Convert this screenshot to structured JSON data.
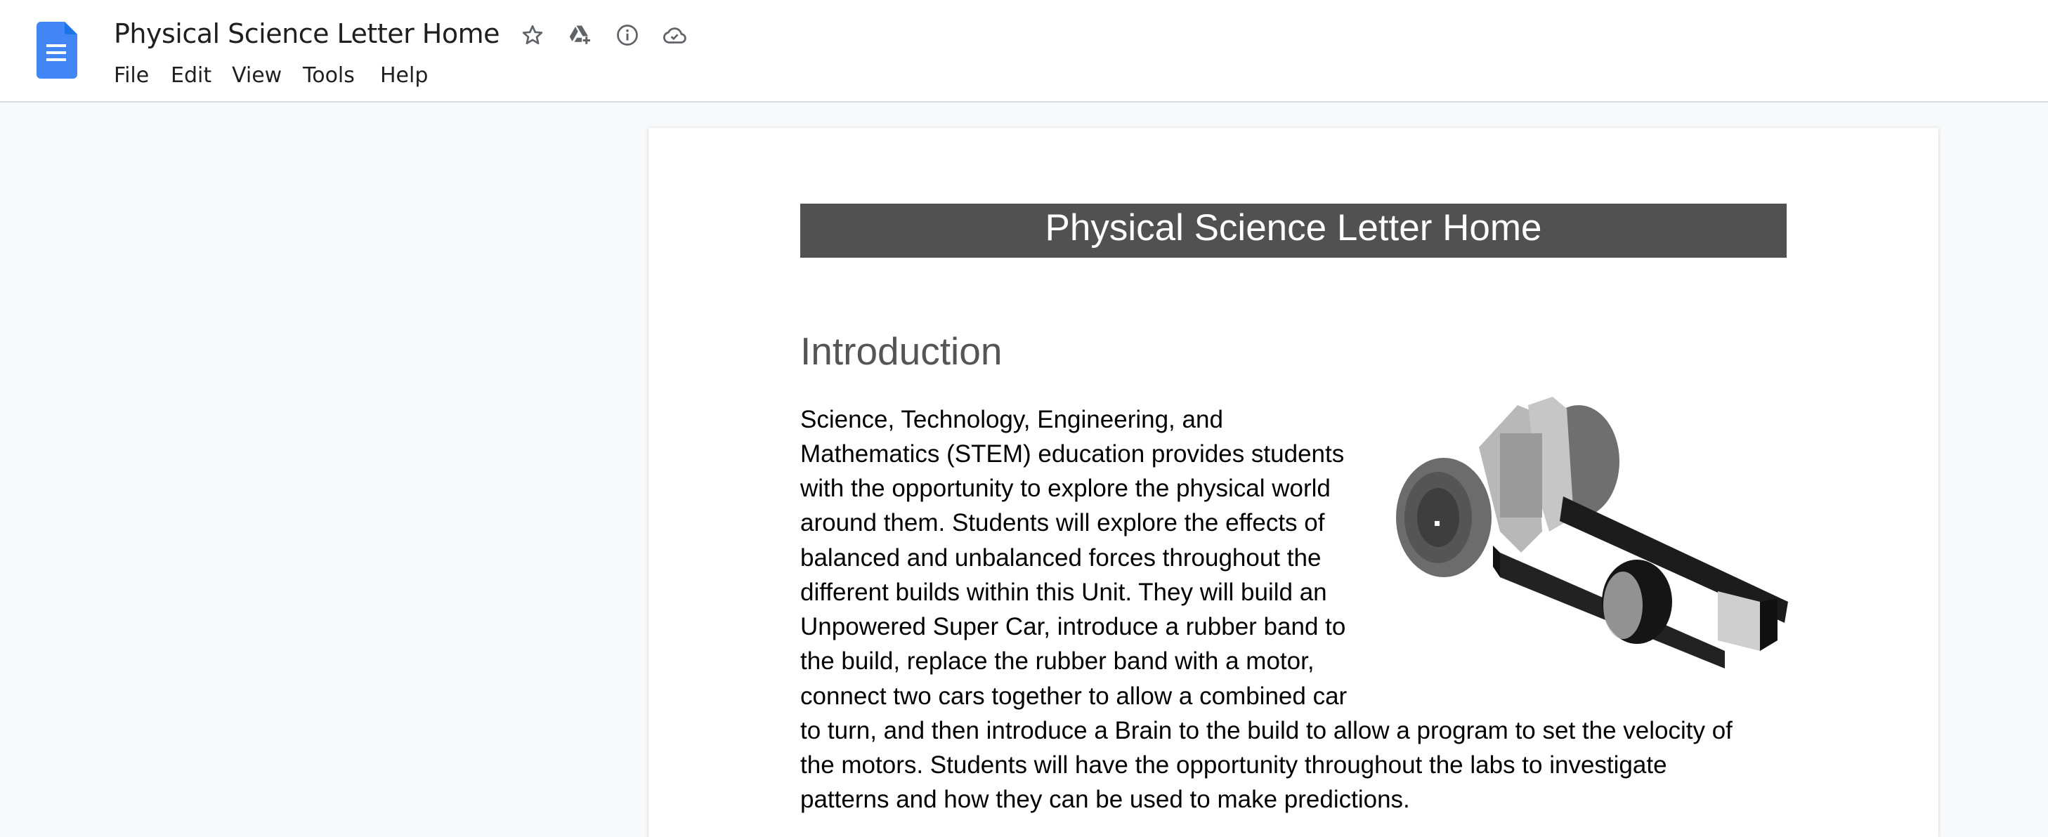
{
  "app": {
    "document_title": "Physical Science Letter Home",
    "title_icons": [
      {
        "name": "star-icon",
        "label": "Star"
      },
      {
        "name": "move-to-drive-icon",
        "label": "Add shortcut to Drive"
      },
      {
        "name": "info-icon",
        "label": "Document details"
      },
      {
        "name": "cloud-saved-icon",
        "label": "Document status"
      }
    ],
    "menu": [
      "File",
      "Edit",
      "View",
      "Tools",
      "Help"
    ],
    "colors": {
      "docs_blue": "#4285f4",
      "icon_gray": "#5f6368",
      "banner_bg": "#515151"
    }
  },
  "document": {
    "banner_title": "Physical Science Letter Home",
    "section_heading": "Introduction",
    "paragraph_lines": [
      "Science, Technology, Engineering, and",
      "Mathematics (STEM) education provides students",
      "with the opportunity to explore the physical world",
      "around them. Students will explore the effects of",
      "balanced and unbalanced forces throughout the",
      "different builds within this Unit. They will build an",
      "Unpowered Super Car, introduce a rubber band to",
      "the build, replace the rubber band with a motor,",
      "connect two cars together to allow a combined car",
      "to turn, and then introduce a Brain to the build to allow a program to set the velocity of",
      "the motors. Students will have the opportunity throughout the labs to investigate",
      "patterns and how they can be used to make predictions."
    ],
    "image": {
      "description": "Rendered robot car build with wheels and black chassis rails"
    }
  }
}
